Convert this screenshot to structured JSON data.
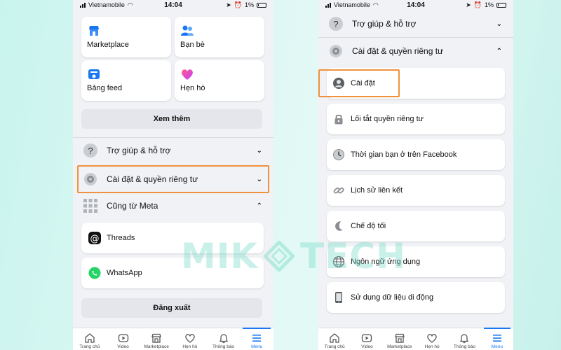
{
  "status_bar": {
    "carrier": "Vietnamobile",
    "time": "14:04",
    "battery": "1%"
  },
  "left": {
    "tiles": [
      {
        "label": "Marketplace",
        "icon": "marketplace-icon"
      },
      {
        "label": "Bạn bè",
        "icon": "friends-icon"
      },
      {
        "label": "Bảng feed",
        "icon": "feed-icon"
      },
      {
        "label": "Hẹn hò",
        "icon": "dating-heart-icon"
      }
    ],
    "see_more": "Xem thêm",
    "sections": {
      "help": "Trợ giúp & hỗ trợ",
      "settings_privacy": "Cài đặt & quyền riêng tư",
      "also_from_meta": "Cũng từ Meta"
    },
    "apps": [
      {
        "label": "Threads",
        "icon": "threads-icon"
      },
      {
        "label": "WhatsApp",
        "icon": "whatsapp-icon"
      }
    ],
    "logout": "Đăng xuất"
  },
  "right": {
    "sections": {
      "help": "Trợ giúp & hỗ trợ",
      "settings_privacy": "Cài đặt & quyền riêng tư"
    },
    "items": [
      {
        "label": "Cài đặt",
        "icon": "profile-icon"
      },
      {
        "label": "Lối tắt quyền riêng tư",
        "icon": "lock-icon"
      },
      {
        "label": "Thời gian bạn ở trên Facebook",
        "icon": "clock-icon"
      },
      {
        "label": "Lịch sử liên kết",
        "icon": "link-icon"
      },
      {
        "label": "Chế độ tối",
        "icon": "moon-icon"
      },
      {
        "label": "Ngôn ngữ ứng dụng",
        "icon": "globe-icon"
      },
      {
        "label": "Sử dụng dữ liệu di động",
        "icon": "phone-icon"
      }
    ]
  },
  "bottom_nav": [
    {
      "label": "Trang chủ",
      "icon": "home-icon"
    },
    {
      "label": "Video",
      "icon": "video-icon"
    },
    {
      "label": "Marketplace",
      "icon": "shop-icon"
    },
    {
      "label": "Hẹn hò",
      "icon": "heart-icon"
    },
    {
      "label": "Thông báo",
      "icon": "bell-icon"
    },
    {
      "label": "Menu",
      "icon": "menu-icon"
    }
  ],
  "watermark": {
    "left": "MIK",
    "right": "TECH"
  },
  "colors": {
    "facebook_blue": "#1877f2",
    "highlight_orange": "#f0913d",
    "background_teal": "#c9f4ee"
  }
}
